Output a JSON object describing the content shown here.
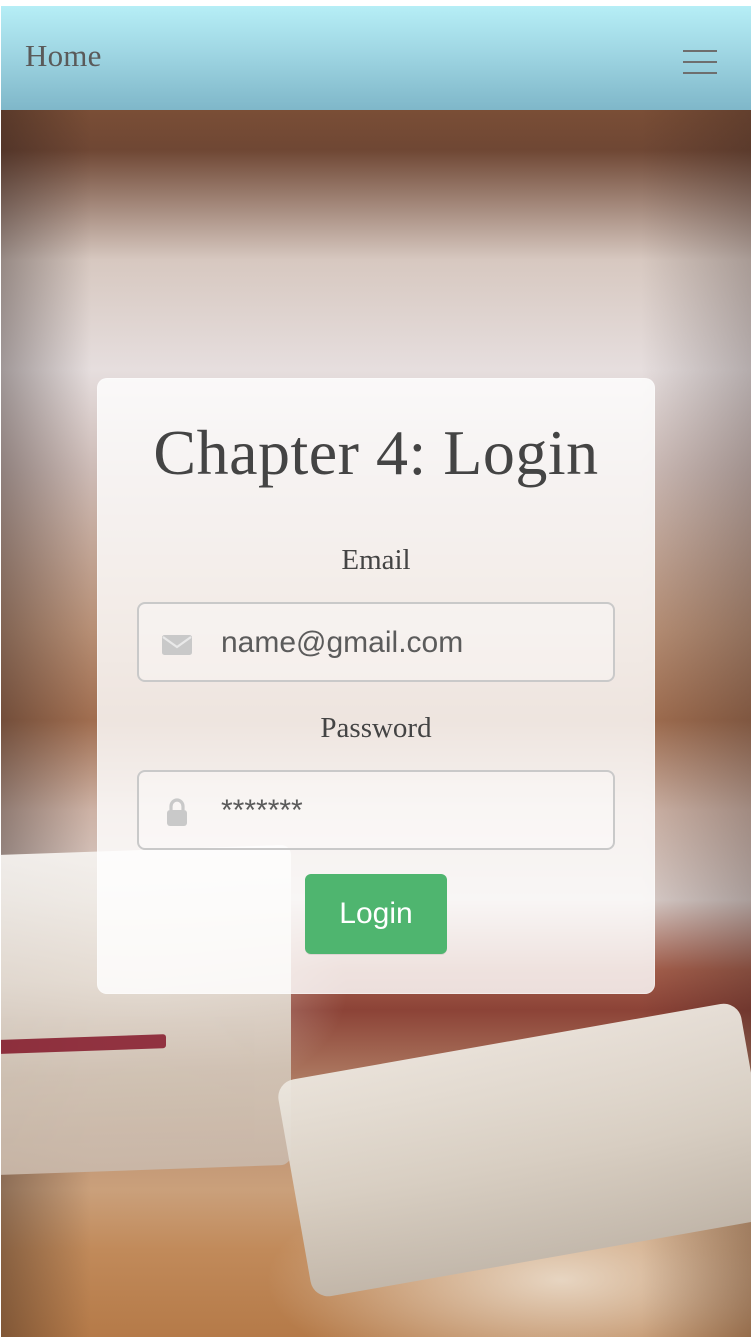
{
  "navbar": {
    "brand": "Home",
    "menu_icon": "hamburger-icon"
  },
  "card": {
    "title": "Chapter 4: Login",
    "email": {
      "label": "Email",
      "placeholder": "name@gmail.com",
      "icon": "envelope-icon"
    },
    "password": {
      "label": "Password",
      "placeholder": "*******",
      "icon": "lock-icon"
    },
    "login_button": "Login"
  },
  "colors": {
    "navbar_top": "#b6eef6",
    "navbar_bottom": "#7fb7c9",
    "button": "#4fb56f",
    "text": "#444444"
  }
}
